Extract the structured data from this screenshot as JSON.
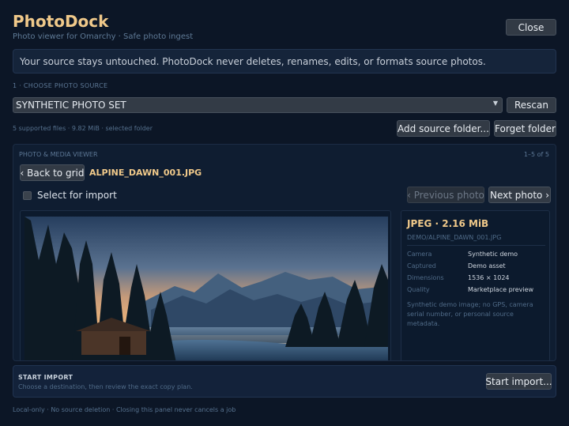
{
  "app": {
    "title": "PhotoDock",
    "subtitle": "Photo viewer for Omarchy · Safe photo ingest",
    "close_label": "Close"
  },
  "notice": "Your source stays untouched. PhotoDock never deletes, renames, edits, or formats source photos.",
  "source": {
    "section_label": "1 · CHOOSE PHOTO SOURCE",
    "selected": "SYNTHETIC PHOTO SET",
    "rescan_label": "Rescan",
    "summary": "5 supported files · 9.82 MiB · selected folder",
    "add_label": "Add source folder...",
    "forget_label": "Forget folder"
  },
  "viewer": {
    "section_label": "PHOTO & MEDIA VIEWER",
    "count": "1–5 of 5",
    "back_label": "‹ Back to grid",
    "file_name": "ALPINE_DAWN_001.JPG",
    "select_label": "Select for import",
    "prev_label": "‹ Previous photo",
    "next_label": "Next photo ›",
    "info": {
      "title": "JPEG · 2.16 MiB",
      "path": "DEMO/ALPINE_DAWN_001.JPG",
      "rows": [
        {
          "key": "Camera",
          "value": "Synthetic demo"
        },
        {
          "key": "Captured",
          "value": "Demo asset"
        },
        {
          "key": "Dimensions",
          "value": "1536 × 1024"
        },
        {
          "key": "Quality",
          "value": "Marketplace preview"
        }
      ],
      "note": "Synthetic demo image; no GPS, camera serial number, or personal source metadata."
    }
  },
  "import": {
    "title": "START IMPORT",
    "subtitle": "Choose a destination, then review the exact copy plan.",
    "button_label": "Start import..."
  },
  "footer": "Local-only · No source deletion · Closing this panel never cancels a job",
  "colors": {
    "background": "#0c1626",
    "accent": "#f0c98a",
    "panel": "#0f1d31",
    "button": "#323a45"
  }
}
